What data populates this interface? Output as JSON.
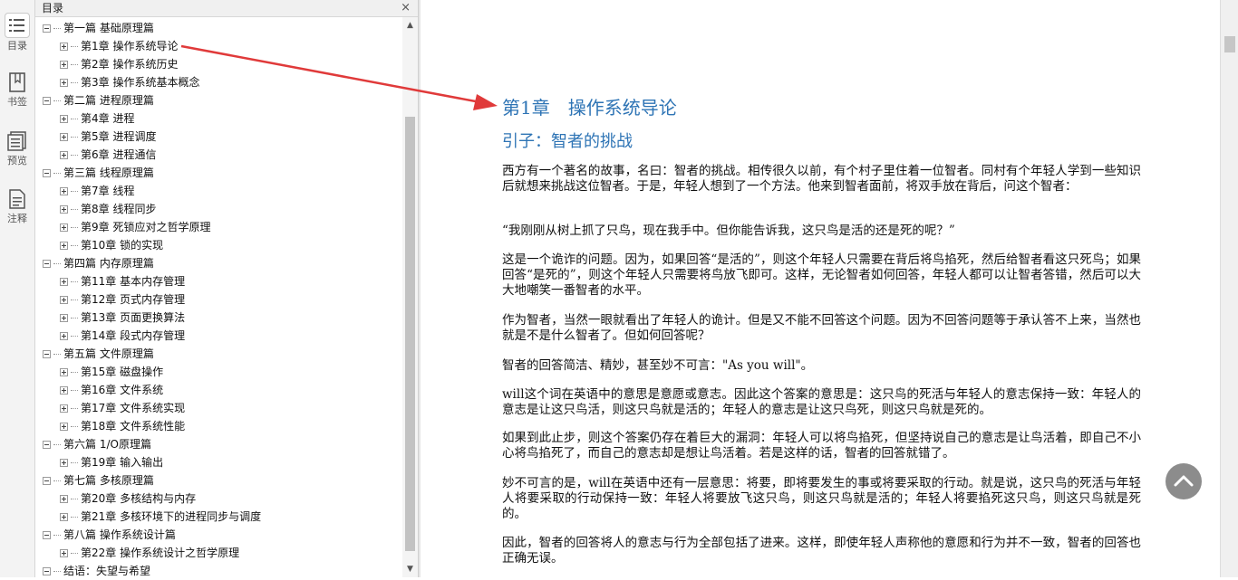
{
  "rail": {
    "items": [
      {
        "label": "目录",
        "icon": "toc-list-icon",
        "active": true
      },
      {
        "label": "书签",
        "icon": "bookmark-icon"
      },
      {
        "label": "预览",
        "icon": "preview-icon"
      },
      {
        "label": "注释",
        "icon": "annotation-icon"
      }
    ]
  },
  "toc": {
    "title": "目录",
    "close": "×",
    "items": [
      {
        "label": "第一篇  基础原理篇",
        "level": 0
      },
      {
        "label": "第1章  操作系统导论",
        "level": 1
      },
      {
        "label": "第2章  操作系统历史",
        "level": 1
      },
      {
        "label": "第3章  操作系统基本概念",
        "level": 1
      },
      {
        "label": "第二篇  进程原理篇",
        "level": 0
      },
      {
        "label": "第4章  进程",
        "level": 1
      },
      {
        "label": "第5章  进程调度",
        "level": 1
      },
      {
        "label": "第6章  进程通信",
        "level": 1
      },
      {
        "label": "第三篇  线程原理篇",
        "level": 0
      },
      {
        "label": "第7章  线程",
        "level": 1
      },
      {
        "label": "第8章  线程同步",
        "level": 1
      },
      {
        "label": "第9章  死锁应对之哲学原理",
        "level": 1
      },
      {
        "label": "第10章  锁的实现",
        "level": 1
      },
      {
        "label": "第四篇  内存原理篇",
        "level": 0
      },
      {
        "label": "第11章  基本内存管理",
        "level": 1
      },
      {
        "label": "第12章  页式内存管理",
        "level": 1
      },
      {
        "label": "第13章  页面更换算法",
        "level": 1
      },
      {
        "label": "第14章  段式内存管理",
        "level": 1
      },
      {
        "label": "第五篇  文件原理篇",
        "level": 0
      },
      {
        "label": "第15章  磁盘操作",
        "level": 1
      },
      {
        "label": "第16章  文件系统",
        "level": 1
      },
      {
        "label": "第17章  文件系统实现",
        "level": 1
      },
      {
        "label": "第18章  文件系统性能",
        "level": 1
      },
      {
        "label": "第六篇  1/O原理篇",
        "level": 0
      },
      {
        "label": "第19章  输入输出",
        "level": 1
      },
      {
        "label": "第七篇  多核原理篇",
        "level": 0
      },
      {
        "label": "第20章  多核结构与内存",
        "level": 1
      },
      {
        "label": "第21章  多核环境下的进程同步与调度",
        "level": 1
      },
      {
        "label": "第八篇  操作系统设计篇",
        "level": 0
      },
      {
        "label": "第22章  操作系统设计之哲学原理",
        "level": 1
      },
      {
        "label": "结语：失望与希望",
        "level": 0
      }
    ]
  },
  "doc": {
    "chapter_title": "第1章　操作系统导论",
    "section_title": "引子：智者的挑战",
    "paragraphs": [
      "西方有一个著名的故事，名曰：智者的挑战。相传很久以前，有个村子里住着一位智者。同村有个年轻人学到一些知识后就想来挑战这位智者。于是，年轻人想到了一个方法。他来到智者面前，将双手放在背后，问这个智者：",
      "“我刚刚从树上抓了只鸟，现在我手中。但你能告诉我，这只鸟是活的还是死的呢？”",
      "这是一个诡诈的问题。因为，如果回答“是活的”，则这个年轻人只需要在背后将鸟掐死，然后给智者看这只死鸟；如果回答“是死的”，则这个年轻人只需要将鸟放飞即可。这样，无论智者如何回答，年轻人都可以让智者答错，然后可以大大地嘲笑一番智者的水平。",
      "作为智者，当然一眼就看出了年轻人的诡计。但是又不能不回答这个问题。因为不回答问题等于承认答不上来，当然也就是不是什么智者了。但如何回答呢？",
      "智者的回答简洁、精妙，甚至妙不可言：\"As you will\"。",
      "will这个词在英语中的意思是意愿或意志。因此这个答案的意思是：这只鸟的死活与年轻人的意志保持一致：年轻人的意志是让这只鸟活，则这只鸟就是活的；年轻人的意志是让这只鸟死，则这只鸟就是死的。",
      "如果到此止步，则这个答案仍存在着巨大的漏洞：年轻人可以将鸟掐死，但坚持说自己的意志是让鸟活着，即自己不小心将鸟掐死了，而自己的意志却是想让鸟活着。若是这样的话，智者的回答就错了。",
      "妙不可言的是，will在英语中还有一层意思：将要，即将要发生的事或将要采取的行动。就是说，这只鸟的死活与年轻人将要采取的行动保持一致：年轻人将要放飞这只鸟，则这只鸟就是活的；年轻人将要掐死这只鸟，则这只鸟就是死的。",
      "因此，智者的回答将人的意志与行为全部包括了进来。这样，即使年轻人声称他的意愿和行为并不一致，智者的回答也正确无误。"
    ]
  },
  "colors": {
    "heading": "#2e74b5",
    "arrow": "#e03a3a"
  }
}
